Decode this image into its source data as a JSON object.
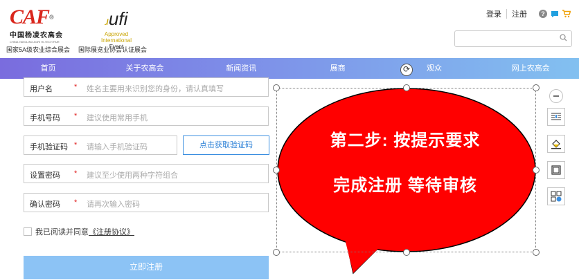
{
  "header": {
    "caf_logo": "CAF",
    "caf_name": "中国杨凌农高会",
    "caf_english": "CHINA YANGLING AGRI HI-TECH FAIR",
    "caf_subtitle": "国家5A级农业综合展会",
    "ufi_logo": "ufi",
    "ufi_line1": "Approved",
    "ufi_line2": "International",
    "ufi_line3": "Event",
    "ufi_subtitle": "国际展览业协会认证展会",
    "login": "登录",
    "register": "注册",
    "search_placeholder": ""
  },
  "nav": {
    "items": [
      "首页",
      "关于农高会",
      "新闻资讯",
      "展商",
      "观众",
      "网上农高会"
    ]
  },
  "form": {
    "username": {
      "label": "用户名",
      "star": "*",
      "placeholder": "姓名主要用来识别您的身份，请认真填写"
    },
    "phone": {
      "label": "手机号码",
      "star": "*",
      "placeholder": "建议使用常用手机"
    },
    "code": {
      "label": "手机验证码",
      "star": "*",
      "placeholder": "请输入手机验证码"
    },
    "get_code_button": "点击获取验证码",
    "password": {
      "label": "设置密码",
      "star": "*",
      "placeholder": "建议至少使用两种字符组合"
    },
    "confirm": {
      "label": "确认密码",
      "star": "*",
      "placeholder": "请再次输入密码"
    },
    "agree_text": "我已阅读并同意",
    "agree_link": "《注册协议》",
    "submit_button": "立即注册"
  },
  "callout": {
    "line1": "第二步: 按提示要求",
    "line2": "完成注册  等待审核",
    "fill_color": "#ff0000"
  },
  "colors": {
    "nav_start": "#7a6cde",
    "nav_end": "#82c0f0",
    "submit": "#8cc3f5",
    "accent_blue": "#2a7fd6"
  },
  "icons": {
    "help": "help-icon",
    "chat": "chat-icon",
    "cart": "cart-icon",
    "search": "search-icon",
    "rotate": "rotate-icon",
    "tools": [
      "minus-icon",
      "layout-options-icon",
      "fill-bucket-icon",
      "outline-icon",
      "arrange-icon"
    ]
  }
}
